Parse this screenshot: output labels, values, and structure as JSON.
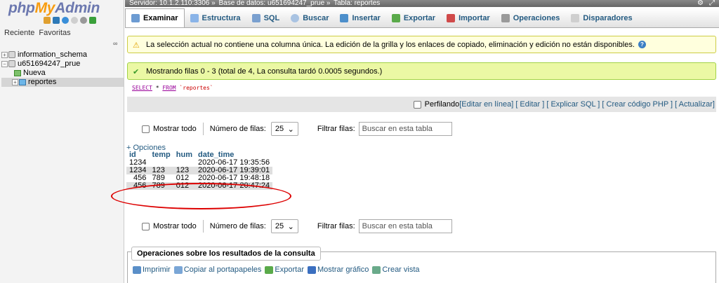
{
  "app": {
    "logo_php": "php",
    "logo_my": "My",
    "logo_admin": "Admin"
  },
  "sidebar": {
    "tabs": [
      "Reciente",
      "Favoritas"
    ],
    "tree": [
      {
        "label": "information_schema"
      },
      {
        "label": "u651694247_prue"
      },
      {
        "label": "Nueva"
      },
      {
        "label": "reportes"
      }
    ]
  },
  "breadcrumb": {
    "server": "Servidor: 10.1.2.110:3306 »",
    "database": "Base de datos: u651694247_prue »",
    "table": "Tabla: reportes"
  },
  "tabs": [
    {
      "label": "Examinar",
      "icon": "browse-icon",
      "color": "#6c9bd2"
    },
    {
      "label": "Estructura",
      "icon": "structure-icon",
      "color": "#8ab4e8"
    },
    {
      "label": "SQL",
      "icon": "sql-icon",
      "color": "#7aa0cf"
    },
    {
      "label": "Buscar",
      "icon": "search-icon",
      "color": "#a9c3e2"
    },
    {
      "label": "Insertar",
      "icon": "insert-icon",
      "color": "#4d8fcb"
    },
    {
      "label": "Exportar",
      "icon": "export-icon",
      "color": "#5aaa4a"
    },
    {
      "label": "Importar",
      "icon": "import-icon",
      "color": "#d04a4a"
    },
    {
      "label": "Operaciones",
      "icon": "wrench-icon",
      "color": "#9a9a9a"
    },
    {
      "label": "Disparadores",
      "icon": "triggers-icon",
      "color": "#cfcfcf"
    }
  ],
  "messages": {
    "warning": "La selección actual no contiene una columna única. La edición de la grilla y los enlaces de copiado, eliminación y edición no están disponibles.",
    "success": "Mostrando filas 0 - 3 (total de 4, La consulta tardó 0.0005 segundos.)"
  },
  "sql": {
    "select": "SELECT",
    "rest": " * ",
    "from": "FROM",
    "table": " `reportes`"
  },
  "profiling": {
    "label": "Perfilando",
    "links": "[Editar en línea] [ Editar ] [ Explicar SQL ] [ Crear código PHP ] [ Actualizar]"
  },
  "navigation": {
    "show_all": "Mostrar todo",
    "rows_label": "Número de filas:",
    "rows_value": "25",
    "filter_label": "Filtrar filas:",
    "filter_placeholder": "Buscar en esta tabla"
  },
  "results": {
    "options": "+ Opciones",
    "columns": [
      "id",
      "temp",
      "hum",
      "date_time"
    ],
    "rows": [
      [
        "1234",
        "",
        "",
        "2020-06-17 19:35:56"
      ],
      [
        "1234",
        "123",
        "123",
        "2020-06-17 19:39:01"
      ],
      [
        "456",
        "789",
        "012",
        "2020-06-17 19:48:18"
      ],
      [
        "456",
        "789",
        "012",
        "2020-06-17 20:47:24"
      ]
    ]
  },
  "operations": {
    "title": "Operaciones sobre los resultados de la consulta",
    "links": [
      "Imprimir",
      "Copiar al portapapeles",
      "Exportar",
      "Mostrar gráfico",
      "Crear vista"
    ]
  },
  "colors": {
    "link": "#235a81",
    "warning_bg": "#ffffdd",
    "success_bg": "#ebf8a4",
    "annotation": "#dd0000"
  }
}
